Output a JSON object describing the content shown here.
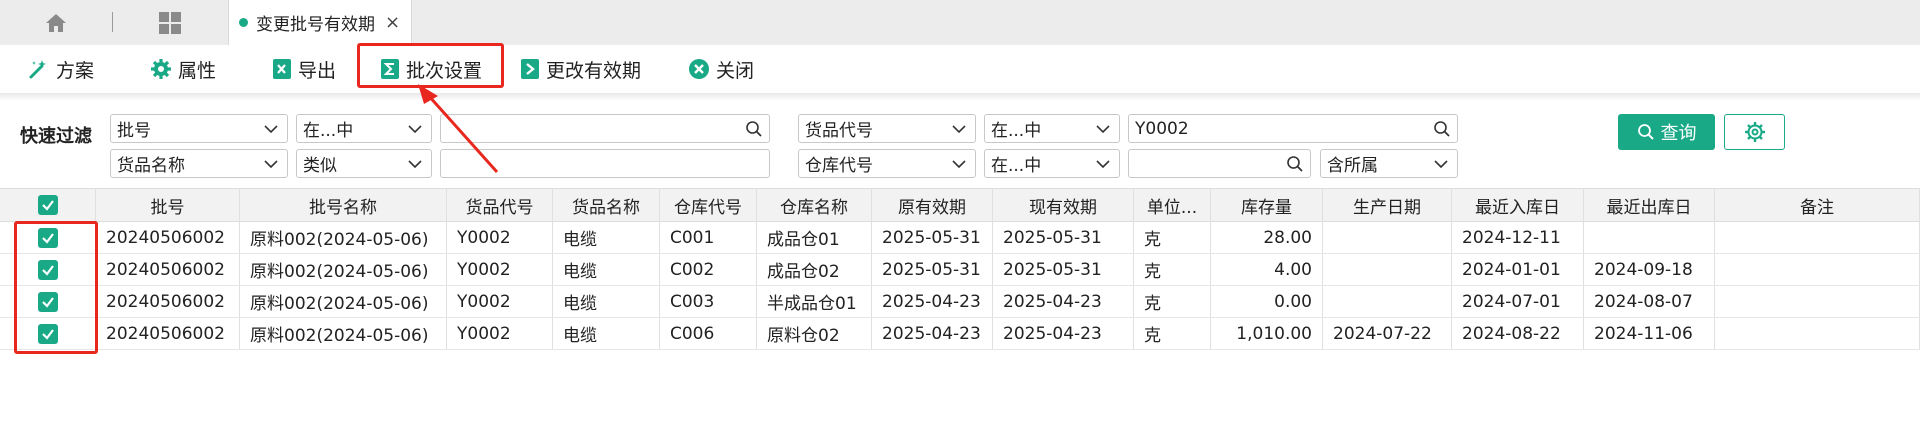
{
  "tabs": {
    "home_icon": "home-icon",
    "grid_icon": "grid-icon",
    "active_label": "变更批号有效期",
    "close_glyph": "×"
  },
  "toolbar": {
    "scheme": "方案",
    "properties": "属性",
    "export": "导出",
    "batch_settings": "批次设置",
    "change_validity": "更改有效期",
    "close": "关闭"
  },
  "filter": {
    "label": "快速过滤",
    "row1": {
      "field1": "批号",
      "op1": "在...中",
      "value1": "",
      "field2": "货品代号",
      "op2": "在...中",
      "value2": "Y0002"
    },
    "row2": {
      "field1": "货品名称",
      "op1": "类似",
      "value1": "",
      "field2": "仓库代号",
      "op2": "在...中",
      "value2": "",
      "option": "含所属"
    },
    "query_button": "查询"
  },
  "grid": {
    "columns": [
      "批号",
      "批号名称",
      "货品代号",
      "货品名称",
      "仓库代号",
      "仓库名称",
      "原有效期",
      "现有效期",
      "单位...",
      "库存量",
      "生产日期",
      "最近入库日",
      "最近出库日",
      "备注"
    ],
    "rows": [
      [
        "20240506002",
        "原料002(2024-05-06)",
        "Y0002",
        "电缆",
        "C001",
        "成品仓01",
        "2025-05-31",
        "2025-05-31",
        "克",
        "28.00",
        "",
        "2024-12-11",
        "",
        ""
      ],
      [
        "20240506002",
        "原料002(2024-05-06)",
        "Y0002",
        "电缆",
        "C002",
        "成品仓02",
        "2025-05-31",
        "2025-05-31",
        "克",
        "4.00",
        "",
        "2024-01-01",
        "2024-09-18",
        ""
      ],
      [
        "20240506002",
        "原料002(2024-05-06)",
        "Y0002",
        "电缆",
        "C003",
        "半成品仓01",
        "2025-04-23",
        "2025-04-23",
        "克",
        "0.00",
        "",
        "2024-07-01",
        "2024-08-07",
        ""
      ],
      [
        "20240506002",
        "原料002(2024-05-06)",
        "Y0002",
        "电缆",
        "C006",
        "原料仓02",
        "2025-04-23",
        "2025-04-23",
        "克",
        "1,010.00",
        "2024-07-22",
        "2024-08-22",
        "2024-11-06",
        ""
      ]
    ]
  },
  "colors": {
    "accent": "#19a987",
    "highlight": "#e8281e"
  }
}
